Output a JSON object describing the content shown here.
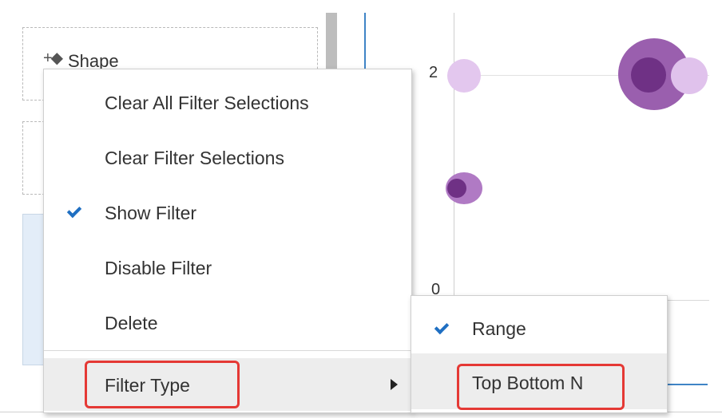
{
  "filter_panel": {
    "shape_label": "Shape"
  },
  "chart": {
    "y_ticks": [
      "2",
      "0"
    ]
  },
  "context_menu": {
    "items": [
      {
        "label": "Clear All Filter Selections",
        "checked": false
      },
      {
        "label": "Clear Filter Selections",
        "checked": false
      },
      {
        "label": "Show Filter",
        "checked": true
      },
      {
        "label": "Disable Filter",
        "checked": false
      },
      {
        "label": "Delete",
        "checked": false
      },
      {
        "label": "Filter Type",
        "checked": false,
        "has_submenu": true,
        "highlighted": true
      }
    ]
  },
  "submenu": {
    "items": [
      {
        "label": "Range",
        "checked": true
      },
      {
        "label": "Top Bottom N",
        "checked": false,
        "highlighted": true
      }
    ]
  },
  "colors": {
    "accent_check": "#1f6fc2",
    "highlight_border": "#e53935",
    "bubble_purple": "#7a3f91",
    "bubble_light": "#d9b6e6"
  },
  "icons": {
    "add_shape": "plus-diamond-icon",
    "check": "checkmark-icon",
    "submenu": "triangle-right-icon"
  }
}
